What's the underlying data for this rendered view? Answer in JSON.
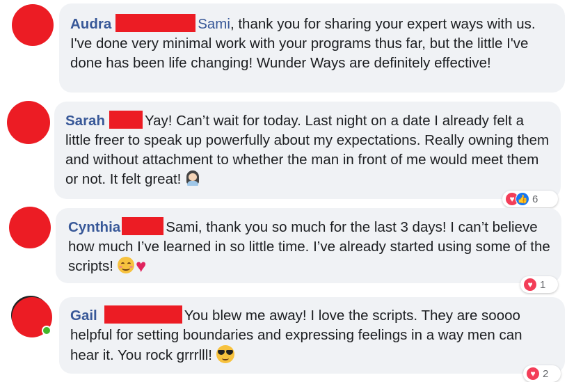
{
  "comments": [
    {
      "name": "Audra",
      "mention": "Sami",
      "text": ", thank you for sharing your expert ways with us. I've done very minimal work with your programs thus far, but the little I've done has been life changing! Wunder Ways are definitely effective!"
    },
    {
      "name": "Sarah",
      "text": "Yay! Can’t wait for today. Last night on a date I already felt a little freer to speak up powerfully about my expectations. Really owning them and without attachment to whether the man in front of me would meet them or not. It felt great!",
      "emoji": "woman-emoji",
      "reaction_count": "6"
    },
    {
      "name": "Cynthia",
      "text": "Sami, thank you so much for the last 3 days! I can’t believe how much I’ve learned in so little time. I’ve already started using some of the scripts!",
      "emoji": [
        "smiling-face-emoji",
        "heart-emoji"
      ],
      "heart_glyph": "♥",
      "reaction_count": "1"
    },
    {
      "name": "Gail",
      "text": "You blew me away! I love the scripts. They are soooo helpful for setting boundaries and expressing feelings in a way men can hear it. You rock grrrlll!",
      "emoji": "sunglasses-emoji",
      "reaction_count": "2"
    }
  ],
  "colors": {
    "name_link": "#385898",
    "bubble_bg": "#f0f2f5",
    "redaction": "#ec1c24",
    "love_reaction": "#f33e58",
    "like_reaction": "#1877f2",
    "online": "#42b72a"
  },
  "icons": {
    "love": "♥",
    "like": "👍"
  }
}
